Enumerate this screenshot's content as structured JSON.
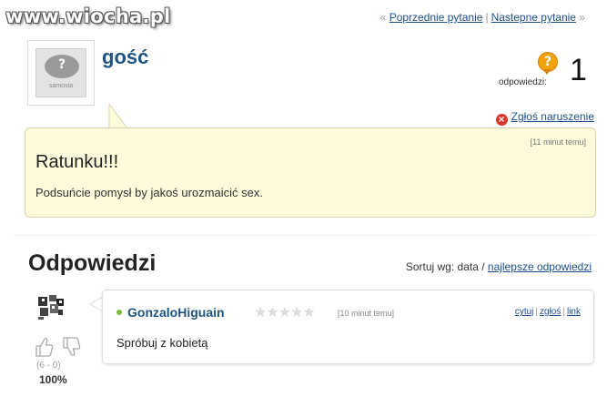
{
  "watermark": "www.wiocha.pl",
  "nav": {
    "prev_label": "Poprzednie pytanie",
    "next_label": "Nastepne pytanie",
    "left_arrow": "«",
    "right_arrow": "»"
  },
  "question": {
    "avatar_text": "samosia",
    "avatar_glyph": "?",
    "username": "gość",
    "answers_label": "odpowiedzi:",
    "answers_count": "1",
    "report_label": "Zgłoś naruszenie",
    "time": "[11 minut temu]",
    "title": "Ratunku!!!",
    "body": "Podsuńcie pomysł by jakoś urozmaicić sex."
  },
  "answers_section": {
    "title": "Odpowiedzi",
    "sort_label": "Sortuj wg:",
    "sort_current": "data",
    "sort_separator": "/",
    "sort_other": "najlepsze odpowiedzi"
  },
  "answers": [
    {
      "username": "GonzaloHiguain",
      "stars_filled": 0,
      "stars_total": 5,
      "time": "[10 minut temu]",
      "actions": {
        "quote": "cytuj",
        "report": "zgłoś",
        "link": "link"
      },
      "text": "Spróbuj z kobietą",
      "votes": "(6 - 0)",
      "percent": "100%"
    }
  ],
  "colors": {
    "link": "#1d4f8c",
    "username": "#1f5480",
    "question_bg": "#fdfbdc",
    "report_icon": "#d9362b",
    "answers_icon": "#f2a20c",
    "online_dot": "#7cb542"
  }
}
